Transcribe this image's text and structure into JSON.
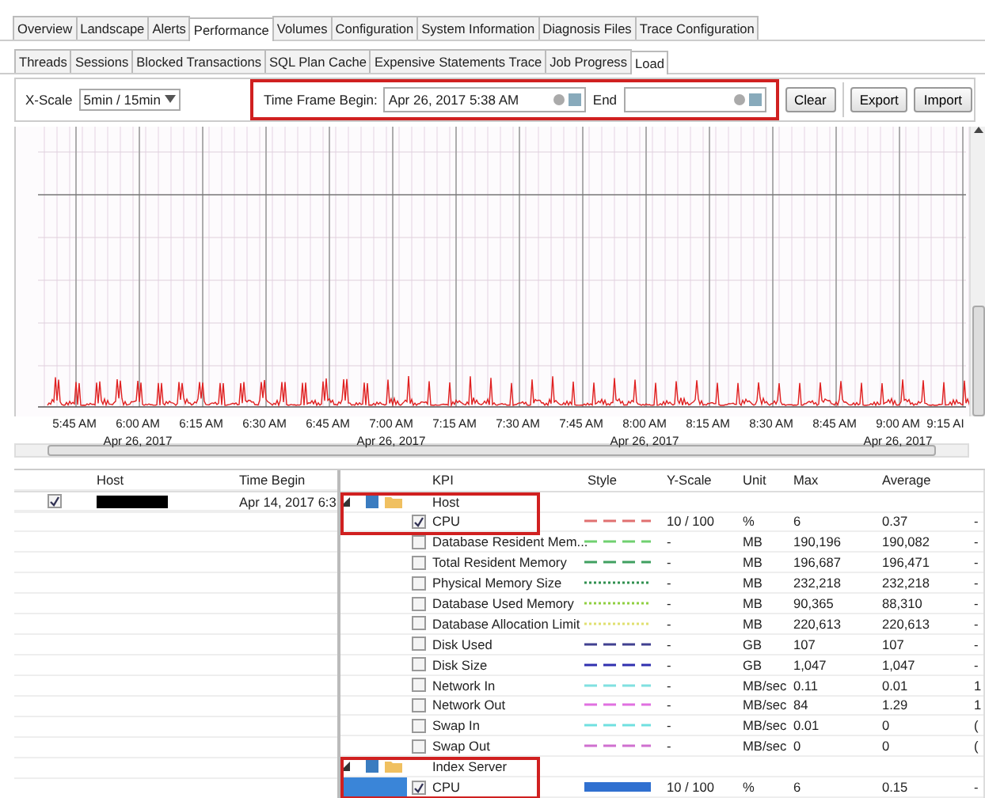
{
  "main_tabs": [
    {
      "label": "Overview",
      "selected": false
    },
    {
      "label": "Landscape",
      "selected": false
    },
    {
      "label": "Alerts",
      "selected": false
    },
    {
      "label": "Performance",
      "selected": true
    },
    {
      "label": "Volumes",
      "selected": false
    },
    {
      "label": "Configuration",
      "selected": false
    },
    {
      "label": "System Information",
      "selected": false
    },
    {
      "label": "Diagnosis Files",
      "selected": false
    },
    {
      "label": "Trace Configuration",
      "selected": false
    }
  ],
  "sub_tabs": [
    {
      "label": "Threads",
      "selected": false
    },
    {
      "label": "Sessions",
      "selected": false
    },
    {
      "label": "Blocked Transactions",
      "selected": false
    },
    {
      "label": "SQL Plan Cache",
      "selected": false
    },
    {
      "label": "Expensive Statements Trace",
      "selected": false
    },
    {
      "label": "Job Progress",
      "selected": false
    },
    {
      "label": "Load",
      "selected": true
    }
  ],
  "toolbar": {
    "x_scale_label": "X-Scale",
    "x_scale_value": "5min / 15min",
    "time_frame": {
      "highlighted": true,
      "begin_label": "Time Frame Begin:",
      "begin_value": "Apr 26, 2017 5:38 AM",
      "end_label": "End"
    },
    "buttons": [
      "Clear",
      "Export",
      "Import"
    ]
  },
  "chart": {
    "time_labels": [
      "5:45 AM",
      "6:00 AM",
      "6:15 AM",
      "6:30 AM",
      "6:45 AM",
      "7:00 AM",
      "7:15 AM",
      "7:30 AM",
      "7:45 AM",
      "8:00 AM",
      "8:15 AM",
      "8:30 AM",
      "8:45 AM",
      "9:00 AM",
      "9:15 AI"
    ],
    "date_labels": [
      "Apr 26, 2017",
      "Apr 26, 2017",
      "Apr 26, 2017",
      "Apr 26, 2017"
    ]
  },
  "hosts_table": {
    "columns": [
      "Host",
      "Time Begin"
    ],
    "rows": [
      {
        "checked": true,
        "host_redacted": true,
        "time_begin": "Apr 14, 2017 6:3"
      }
    ]
  },
  "kpi_table": {
    "columns": [
      "KPI",
      "Style",
      "Y-Scale",
      "Unit",
      "Max",
      "Average"
    ],
    "groups": [
      {
        "name": "Host",
        "expanded": true,
        "highlighted": true,
        "children": [
          {
            "name": "CPU",
            "checked": true,
            "selected": false,
            "color": "#e07070",
            "kind": "dash",
            "y_scale": "10 / 100",
            "unit": "%",
            "max": "6",
            "average": "0.37",
            "column_8": "-"
          },
          {
            "name": "Database Resident Mem...",
            "checked": false,
            "selected": false,
            "color": "#70d070",
            "kind": "dash",
            "y_scale": "-",
            "unit": "MB",
            "max": "190,196",
            "average": "190,082",
            "column_8": "-"
          },
          {
            "name": "Total Resident Memory",
            "checked": false,
            "selected": false,
            "color": "#40a060",
            "kind": "dash",
            "y_scale": "-",
            "unit": "MB",
            "max": "196,687",
            "average": "196,471",
            "column_8": "-"
          },
          {
            "name": "Physical Memory Size",
            "checked": false,
            "selected": false,
            "color": "#309050",
            "kind": "dot",
            "y_scale": "-",
            "unit": "MB",
            "max": "232,218",
            "average": "232,218",
            "column_8": "-"
          },
          {
            "name": "Database Used Memory",
            "checked": false,
            "selected": false,
            "color": "#90d040",
            "kind": "dot",
            "y_scale": "-",
            "unit": "MB",
            "max": "90,365",
            "average": "88,310",
            "column_8": "-"
          },
          {
            "name": "Database Allocation Limit",
            "checked": false,
            "selected": false,
            "color": "#e0e070",
            "kind": "dot",
            "y_scale": "-",
            "unit": "MB",
            "max": "220,613",
            "average": "220,613",
            "column_8": "-"
          },
          {
            "name": "Disk Used",
            "checked": false,
            "selected": false,
            "color": "#404090",
            "kind": "dash",
            "y_scale": "-",
            "unit": "GB",
            "max": "107",
            "average": "107",
            "column_8": "-"
          },
          {
            "name": "Disk Size",
            "checked": false,
            "selected": false,
            "color": "#3030b0",
            "kind": "dash",
            "y_scale": "-",
            "unit": "GB",
            "max": "1,047",
            "average": "1,047",
            "column_8": "-"
          },
          {
            "name": "Network In",
            "checked": false,
            "selected": false,
            "color": "#80e0e0",
            "kind": "dash",
            "y_scale": "-",
            "unit": "MB/sec",
            "max": "0.11",
            "average": "0.01",
            "column_8": "1"
          },
          {
            "name": "Network Out",
            "checked": false,
            "selected": false,
            "color": "#e070e0",
            "kind": "dash",
            "y_scale": "-",
            "unit": "MB/sec",
            "max": "84",
            "average": "1.29",
            "column_8": "1"
          },
          {
            "name": "Swap In",
            "checked": false,
            "selected": false,
            "color": "#70e0e0",
            "kind": "dash",
            "y_scale": "-",
            "unit": "MB/sec",
            "max": "0.01",
            "average": "0",
            "column_8": "("
          },
          {
            "name": "Swap Out",
            "checked": false,
            "selected": false,
            "color": "#d070d0",
            "kind": "dash",
            "y_scale": "-",
            "unit": "MB/sec",
            "max": "0",
            "average": "0",
            "column_8": "("
          }
        ]
      },
      {
        "name": "Index Server",
        "expanded": true,
        "highlighted": true,
        "children": [
          {
            "name": "CPU",
            "checked": true,
            "selected": true,
            "color": "#3070d0",
            "kind": "solid",
            "y_scale": "10 / 100",
            "unit": "%",
            "max": "6",
            "average": "0.15",
            "column_8": "-"
          }
        ]
      }
    ]
  }
}
